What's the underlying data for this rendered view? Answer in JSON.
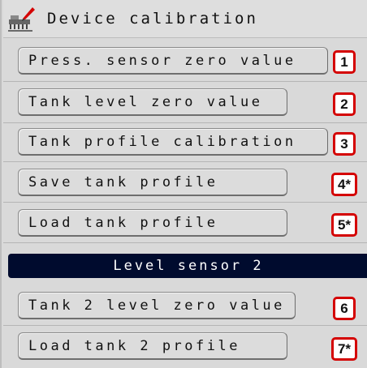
{
  "title": "Device calibration",
  "buttons": [
    {
      "label": "Press. sensor zero value",
      "badge": "1"
    },
    {
      "label": "Tank level zero value",
      "badge": "2"
    },
    {
      "label": "Tank profile calibration",
      "badge": "3"
    },
    {
      "label": "Save tank profile",
      "badge": "4*"
    },
    {
      "label": "Load tank profile",
      "badge": "5*"
    }
  ],
  "section_header": "Level sensor 2",
  "buttons2": [
    {
      "label": "Tank 2 level zero value",
      "badge": "6"
    },
    {
      "label": "Load tank 2 profile",
      "badge": "7*"
    }
  ],
  "colors": {
    "badge_border": "#d40000",
    "section_bg": "#000b2e",
    "panel_bg": "#d9d9d9"
  },
  "icons": {
    "title": "seeder-calibration-icon"
  }
}
